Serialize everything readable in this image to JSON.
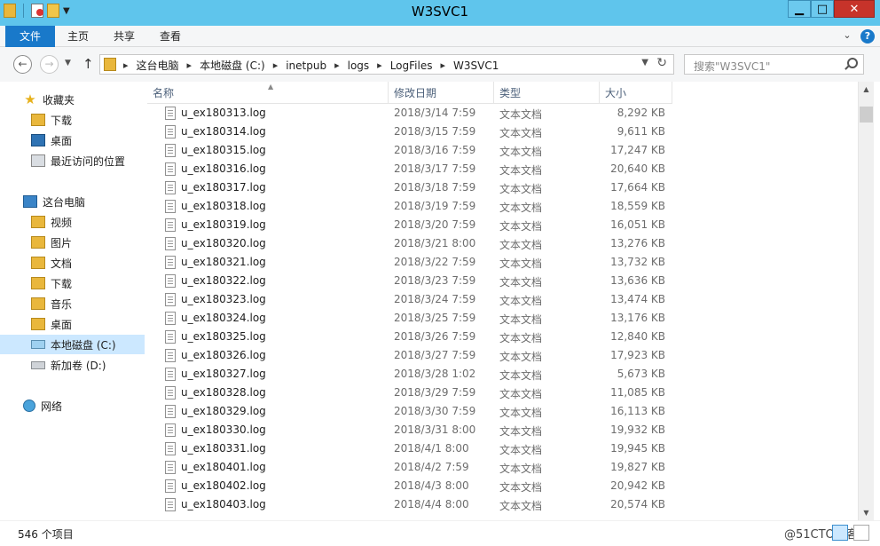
{
  "window": {
    "title": "W3SVC1"
  },
  "window_buttons": {
    "minimize": "▁",
    "maximize": "□",
    "close": "✕"
  },
  "ribbon": {
    "tabs": [
      "文件",
      "主页",
      "共享",
      "查看"
    ],
    "expand_glyph": "⌄",
    "help_glyph": "?"
  },
  "address": {
    "breadcrumbs": [
      "这台电脑",
      "本地磁盘 (C:)",
      "inetpub",
      "logs",
      "LogFiles",
      "W3SVC1"
    ],
    "search_placeholder": "搜索\"W3SVC1\""
  },
  "nav_pane": {
    "favorites": {
      "label": "收藏夹",
      "items": [
        "下载",
        "桌面",
        "最近访问的位置"
      ]
    },
    "this_pc": {
      "label": "这台电脑",
      "items": [
        "视频",
        "图片",
        "文档",
        "下载",
        "音乐",
        "桌面",
        "本地磁盘 (C:)",
        "新加卷 (D:)"
      ],
      "selected": "本地磁盘 (C:)"
    },
    "network": {
      "label": "网络"
    }
  },
  "file_list": {
    "columns": [
      "名称",
      "修改日期",
      "类型",
      "大小"
    ],
    "rows": [
      {
        "name": "u_ex180313.log",
        "date": "2018/3/14 7:59",
        "type": "文本文档",
        "size": "8,292 KB"
      },
      {
        "name": "u_ex180314.log",
        "date": "2018/3/15 7:59",
        "type": "文本文档",
        "size": "9,611 KB"
      },
      {
        "name": "u_ex180315.log",
        "date": "2018/3/16 7:59",
        "type": "文本文档",
        "size": "17,247 KB"
      },
      {
        "name": "u_ex180316.log",
        "date": "2018/3/17 7:59",
        "type": "文本文档",
        "size": "20,640 KB"
      },
      {
        "name": "u_ex180317.log",
        "date": "2018/3/18 7:59",
        "type": "文本文档",
        "size": "17,664 KB"
      },
      {
        "name": "u_ex180318.log",
        "date": "2018/3/19 7:59",
        "type": "文本文档",
        "size": "18,559 KB"
      },
      {
        "name": "u_ex180319.log",
        "date": "2018/3/20 7:59",
        "type": "文本文档",
        "size": "16,051 KB"
      },
      {
        "name": "u_ex180320.log",
        "date": "2018/3/21 8:00",
        "type": "文本文档",
        "size": "13,276 KB"
      },
      {
        "name": "u_ex180321.log",
        "date": "2018/3/22 7:59",
        "type": "文本文档",
        "size": "13,732 KB"
      },
      {
        "name": "u_ex180322.log",
        "date": "2018/3/23 7:59",
        "type": "文本文档",
        "size": "13,636 KB"
      },
      {
        "name": "u_ex180323.log",
        "date": "2018/3/24 7:59",
        "type": "文本文档",
        "size": "13,474 KB"
      },
      {
        "name": "u_ex180324.log",
        "date": "2018/3/25 7:59",
        "type": "文本文档",
        "size": "13,176 KB"
      },
      {
        "name": "u_ex180325.log",
        "date": "2018/3/26 7:59",
        "type": "文本文档",
        "size": "12,840 KB"
      },
      {
        "name": "u_ex180326.log",
        "date": "2018/3/27 7:59",
        "type": "文本文档",
        "size": "17,923 KB"
      },
      {
        "name": "u_ex180327.log",
        "date": "2018/3/28 1:02",
        "type": "文本文档",
        "size": "5,673 KB"
      },
      {
        "name": "u_ex180328.log",
        "date": "2018/3/29 7:59",
        "type": "文本文档",
        "size": "11,085 KB"
      },
      {
        "name": "u_ex180329.log",
        "date": "2018/3/30 7:59",
        "type": "文本文档",
        "size": "16,113 KB"
      },
      {
        "name": "u_ex180330.log",
        "date": "2018/3/31 8:00",
        "type": "文本文档",
        "size": "19,932 KB"
      },
      {
        "name": "u_ex180331.log",
        "date": "2018/4/1 8:00",
        "type": "文本文档",
        "size": "19,945 KB"
      },
      {
        "name": "u_ex180401.log",
        "date": "2018/4/2 7:59",
        "type": "文本文档",
        "size": "19,827 KB"
      },
      {
        "name": "u_ex180402.log",
        "date": "2018/4/3 8:00",
        "type": "文本文档",
        "size": "20,942 KB"
      },
      {
        "name": "u_ex180403.log",
        "date": "2018/4/4 8:00",
        "type": "文本文档",
        "size": "20,574 KB"
      }
    ]
  },
  "status": {
    "item_count": "546 个项目",
    "watermark": "@51CTO博客"
  },
  "colors": {
    "titlebar": "#5fc5ec",
    "file_tab": "#1979ca",
    "selection": "#cce8ff"
  }
}
